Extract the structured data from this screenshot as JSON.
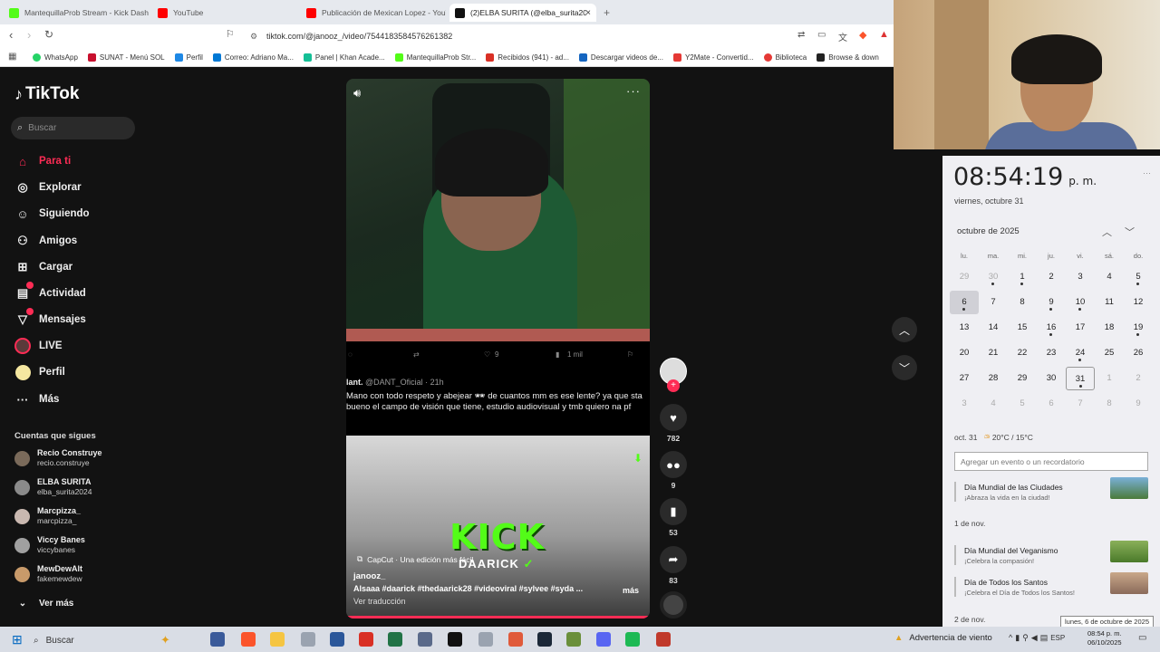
{
  "browser": {
    "tabs": [
      {
        "label": "MantequillaProb Stream - Kick Dash",
        "color": "#53fc18"
      },
      {
        "label": "YouTube",
        "color": "#ff0000"
      },
      {
        "label": "Publicación de Mexican Lopez - YouT",
        "color": "#ff0000"
      },
      {
        "label": "(2)ELBA SURITA (@elba_surita20",
        "color": "#111111"
      }
    ],
    "close_glyph": "×",
    "new_tab_glyph": "+",
    "url": "tiktok.com/@janooz_/video/7544183584576261382",
    "bookmarks": [
      {
        "label": "WhatsApp",
        "color": "#25d366"
      },
      {
        "label": "SUNAT - Menú SOL",
        "color": "#c8102e"
      },
      {
        "label": "Perfil",
        "color": "#1e88e5"
      },
      {
        "label": "Correo: Adriano Ma...",
        "color": "#0078d4"
      },
      {
        "label": "Panel | Khan Acade...",
        "color": "#14bf96"
      },
      {
        "label": "MantequillaProb Str...",
        "color": "#53fc18"
      },
      {
        "label": "Recibidos (941) - ad...",
        "color": "#d93025"
      },
      {
        "label": "Descargar videos de...",
        "color": "#1565c0"
      },
      {
        "label": "Y2Mate - Convertid...",
        "color": "#e53935"
      },
      {
        "label": "Biblioteca",
        "color": "#e53935"
      },
      {
        "label": "Browse & down",
        "color": "#222222"
      }
    ]
  },
  "tiktok": {
    "logo": "TikTok",
    "search_placeholder": "Buscar",
    "nav": [
      {
        "label": "Para ti",
        "icon": "home-icon"
      },
      {
        "label": "Explorar",
        "icon": "compass-icon"
      },
      {
        "label": "Siguiendo",
        "icon": "user-check-icon"
      },
      {
        "label": "Amigos",
        "icon": "friends-icon"
      },
      {
        "label": "Cargar",
        "icon": "upload-icon"
      },
      {
        "label": "Actividad",
        "icon": "activity-icon"
      },
      {
        "label": "Mensajes",
        "icon": "messages-icon"
      },
      {
        "label": "LIVE",
        "icon": "live-icon"
      },
      {
        "label": "Perfil",
        "icon": "profile-icon"
      },
      {
        "label": "Más",
        "icon": "more-icon"
      }
    ],
    "following_title": "Cuentas que sigues",
    "following": [
      {
        "name": "Recio Construye",
        "handle": "recio.construye"
      },
      {
        "name": "ELBA SURITA",
        "handle": "elba_surita2024"
      },
      {
        "name": "Marcpizza_",
        "handle": "marcpizza_"
      },
      {
        "name": "Viccy Banes",
        "handle": "viccybanes"
      },
      {
        "name": "MewDewAlt",
        "handle": "fakemewdew"
      }
    ],
    "see_more": "Ver más",
    "video": {
      "tweet_stats": {
        "likes": "9",
        "views": "1 mil"
      },
      "tweet_author": "lant.",
      "tweet_handle": "@DANT_Oficial · 21h",
      "tweet_text": "Mano con todo respeto y abejear 🕶 de cuantos mm es ese lente? ya que sta bueno el campo de visión que tiene, estudio audiovisual y tmb quiero na pf",
      "overlay_kick": "KICK",
      "overlay_name": "DAARICK",
      "capcut": "CapCut · Una edición más fácil",
      "author": "janooz_",
      "caption": "Alsaaa #daarick #thedaarick28 #videoviral #sylvee #syda ...",
      "more": "más",
      "translate": "Ver traducción"
    },
    "actions": {
      "likes": "782",
      "comments": "9",
      "saves": "53",
      "shares": "83"
    }
  },
  "calendar": {
    "time": "08:54:19",
    "ampm": "p. m.",
    "date_long": "viernes, octubre 31",
    "month": "octubre de 2025",
    "dow": [
      "lu.",
      "ma.",
      "mi.",
      "ju.",
      "vi.",
      "sá.",
      "do."
    ],
    "weeks": [
      [
        "29",
        "30",
        "1",
        "2",
        "3",
        "4",
        "5"
      ],
      [
        "6",
        "7",
        "8",
        "9",
        "10",
        "11",
        "12"
      ],
      [
        "13",
        "14",
        "15",
        "16",
        "17",
        "18",
        "19"
      ],
      [
        "20",
        "21",
        "22",
        "23",
        "24",
        "25",
        "26"
      ],
      [
        "27",
        "28",
        "29",
        "30",
        "31",
        "1",
        "2"
      ],
      [
        "3",
        "4",
        "5",
        "6",
        "7",
        "8",
        "9"
      ]
    ],
    "weather_date": "oct. 31",
    "weather": "20°C / 15°C",
    "add_event_placeholder": "Agregar un evento o un recordatorio",
    "event1_title": "Día Mundial de las Ciudades",
    "event1_sub": "¡Abraza la vida en la ciudad!",
    "section_nov1": "1 de nov.",
    "event2_title": "Día Mundial del Veganismo",
    "event2_sub": "¡Celebra la compasión!",
    "event3_title": "Día de Todos los Santos",
    "event3_sub": "¡Celebra el Día de Todos los Santos!",
    "section_nov2": "2 de nov.",
    "tooltip": "lunes, 6 de octubre de 2025"
  },
  "taskbar": {
    "search": "Buscar",
    "weather": "Advertencia de viento",
    "lang": "ESP",
    "time": "08:54 p. m.",
    "date": "06/10/2025",
    "apps": [
      {
        "icon": "task-view-icon",
        "color": "#3a5a9a"
      },
      {
        "icon": "brave-icon",
        "color": "#fb542b"
      },
      {
        "icon": "folder-icon",
        "color": "#f5c542"
      },
      {
        "icon": "app-icon",
        "color": "#9aa3b0"
      },
      {
        "icon": "word-icon",
        "color": "#2b579a"
      },
      {
        "icon": "pdf-icon",
        "color": "#d93025"
      },
      {
        "icon": "excel-icon",
        "color": "#217346"
      },
      {
        "icon": "calculator-icon",
        "color": "#5a6a8a"
      },
      {
        "icon": "capcut-icon",
        "color": "#111111"
      },
      {
        "icon": "app-icon",
        "color": "#9aa3b0"
      },
      {
        "icon": "app-icon",
        "color": "#e05a3a"
      },
      {
        "icon": "steam-icon",
        "color": "#1b2838"
      },
      {
        "icon": "minecraft-icon",
        "color": "#6a8f3a"
      },
      {
        "icon": "discord-icon",
        "color": "#5865f2"
      },
      {
        "icon": "spotify-icon",
        "color": "#1db954"
      },
      {
        "icon": "app-icon",
        "color": "#c0392b"
      }
    ]
  }
}
